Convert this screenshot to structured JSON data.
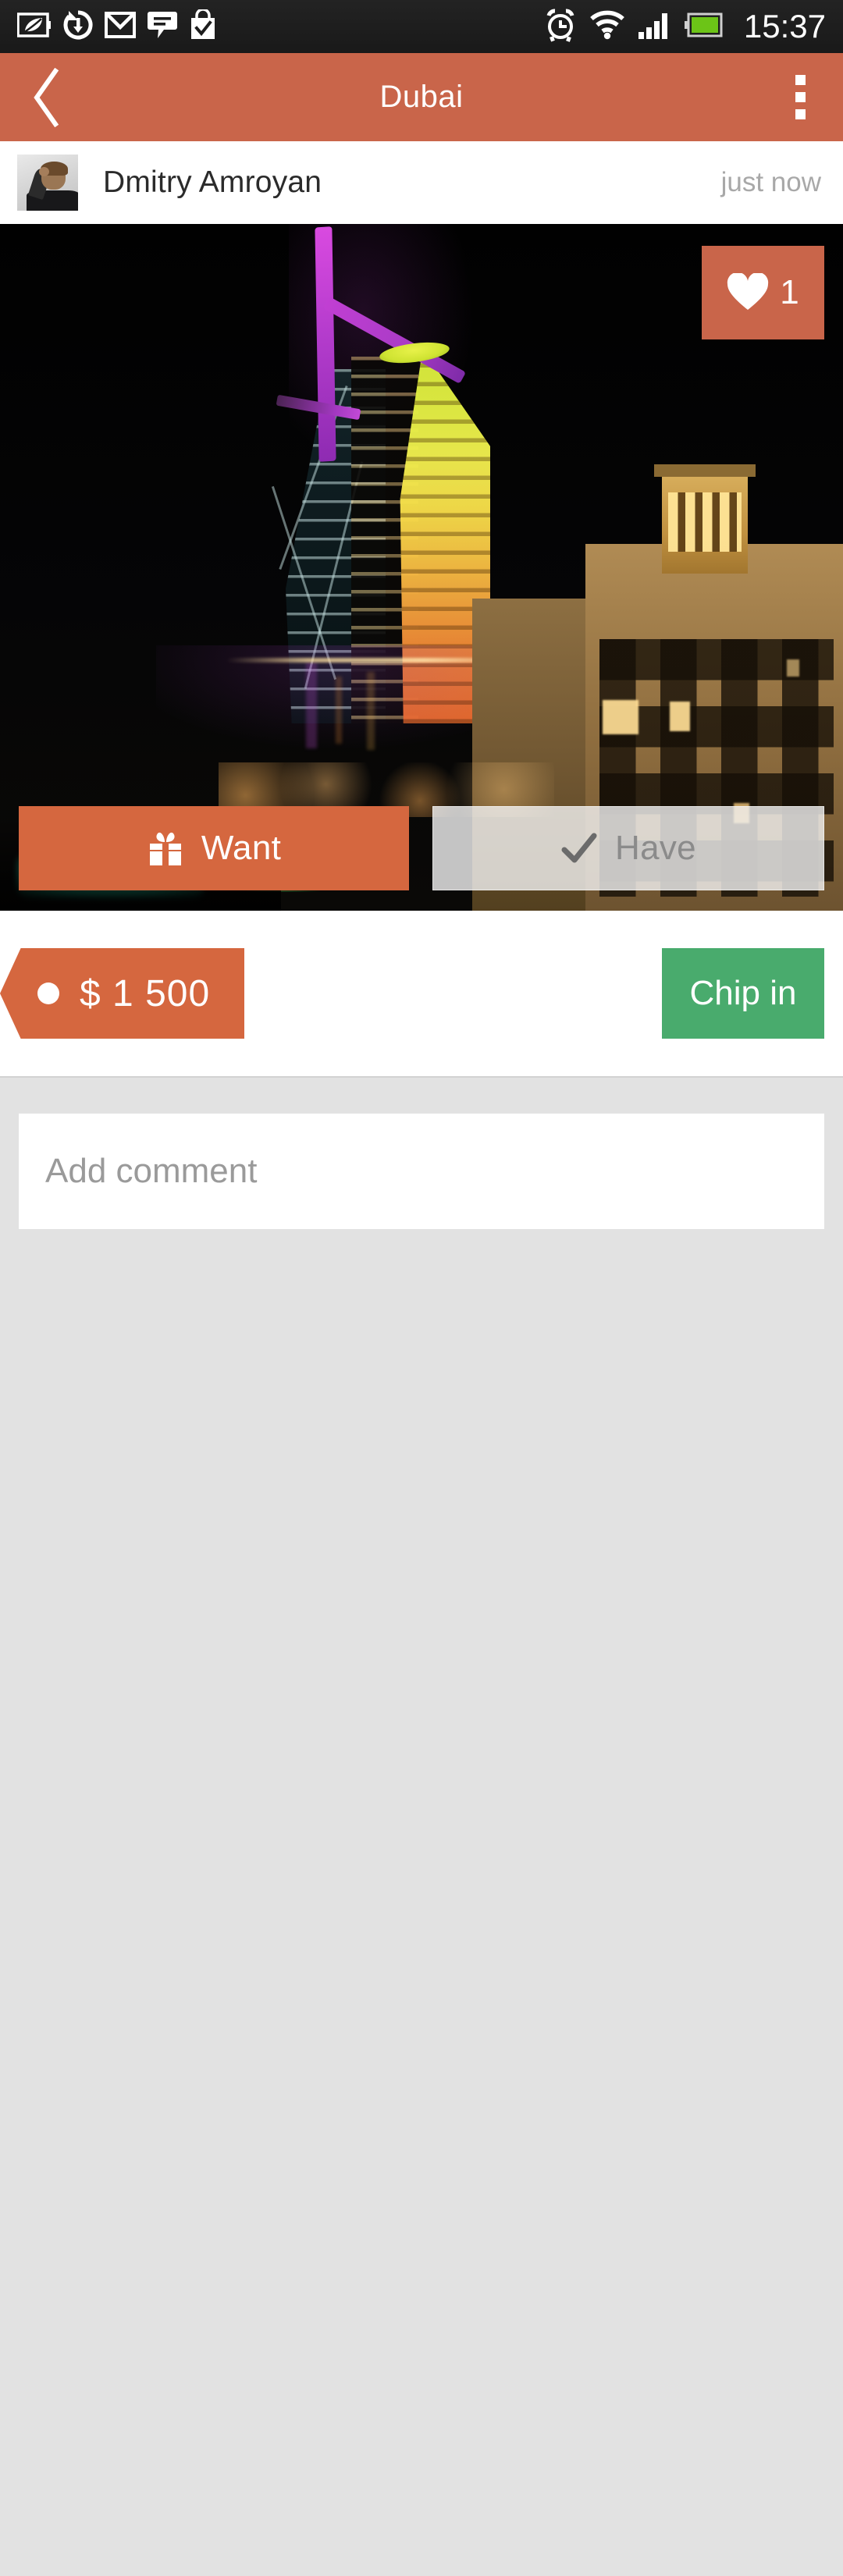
{
  "status_bar": {
    "icons_left": [
      {
        "name": "power-saving-leaf-icon",
        "label": "power saving"
      },
      {
        "name": "sync-icon",
        "label": "sync"
      },
      {
        "name": "gmail-icon",
        "label": "Gmail"
      },
      {
        "name": "messages-icon",
        "label": "Messages"
      },
      {
        "name": "shopping-bag-check-icon",
        "label": "Shop"
      }
    ],
    "icons_right": [
      {
        "name": "alarm-clock-icon",
        "label": "alarm"
      },
      {
        "name": "wifi-icon",
        "label": "wifi"
      },
      {
        "name": "cellular-signal-icon",
        "label": "signal"
      },
      {
        "name": "battery-icon",
        "label": "battery"
      }
    ],
    "time": "15:37",
    "background": "#1d1d1d",
    "battery_color": "#6cc417"
  },
  "app_bar": {
    "back_label": "Back",
    "title": "Dubai",
    "menu_label": "More options",
    "background": "#c9654a"
  },
  "post": {
    "author_name": "Dmitry Amroyan",
    "timestamp": "just now",
    "avatar_alt": "Dmitry Amroyan profile photo"
  },
  "photo": {
    "alt": "Burj Al Arab hotel lit up at night in Dubai",
    "like": {
      "icon": "heart-icon",
      "count": "1",
      "background": "#c9654a"
    },
    "buttons": {
      "want_label": "Want",
      "want_icon": "gift-icon",
      "want_background": "#d5673f",
      "have_label": "Have",
      "have_icon": "check-icon",
      "have_background": "rgba(244,244,244,0.80)"
    }
  },
  "price": {
    "amount": "$ 1 500",
    "tag_background": "#d5673f",
    "chip_in_label": "Chip in",
    "chip_in_background": "#49ab6d"
  },
  "comment": {
    "placeholder": "Add comment",
    "value": "",
    "section_background": "#e2e2e2"
  }
}
